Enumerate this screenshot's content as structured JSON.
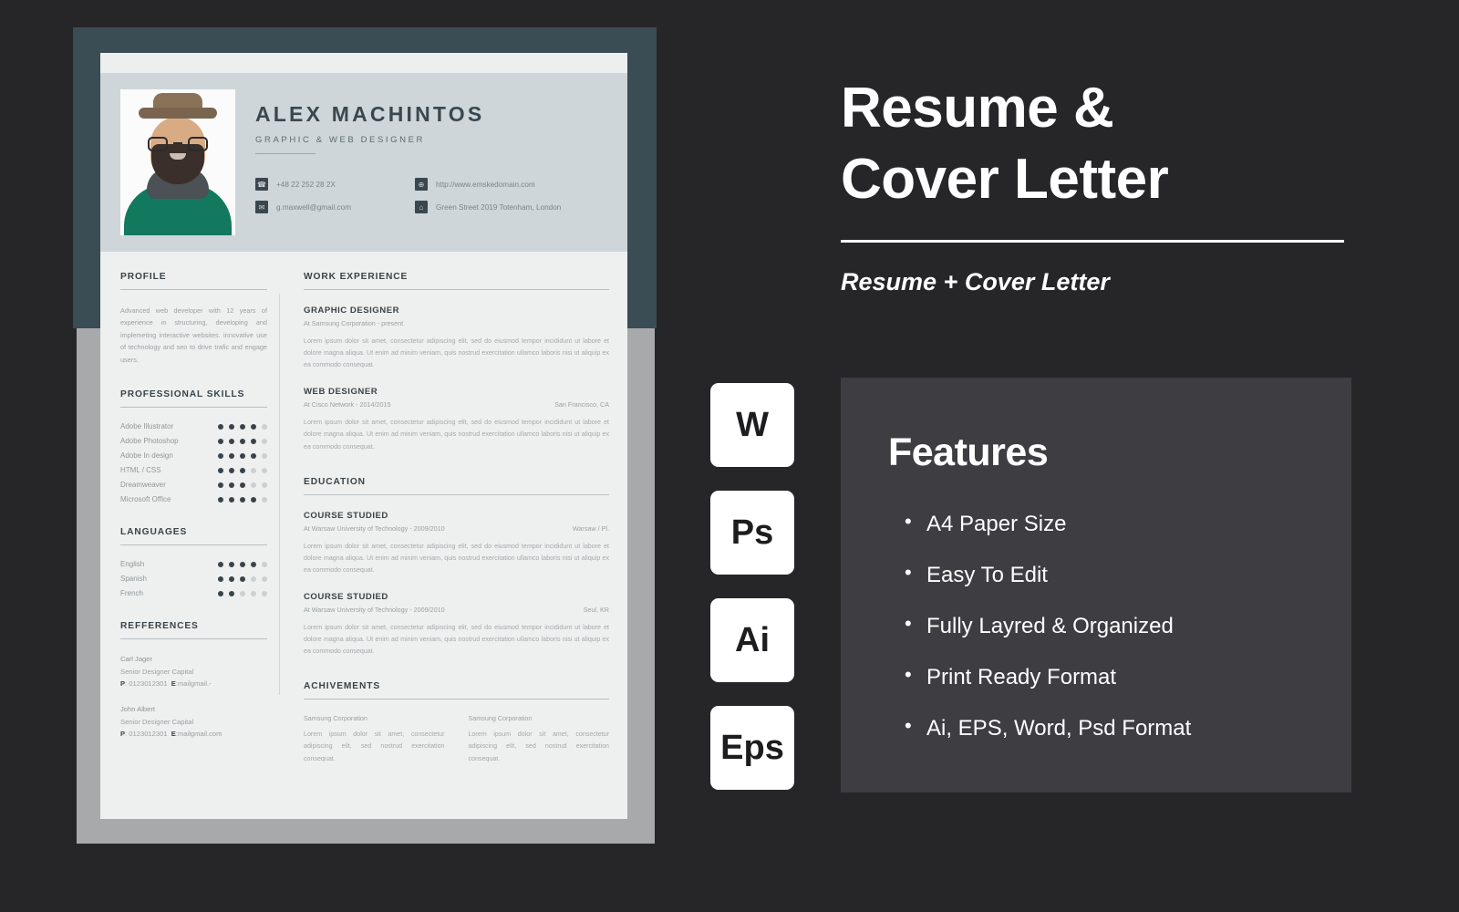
{
  "resume": {
    "name": "ALEX MACHINTOS",
    "role": "GRAPHIC & WEB DESIGNER",
    "contacts": [
      {
        "icon": "phone-icon",
        "glyph": "☎",
        "text": "+48 22 252 28 2X"
      },
      {
        "icon": "globe-icon",
        "glyph": "⊕",
        "text": "http://www.emskedomain.com"
      },
      {
        "icon": "mail-icon",
        "glyph": "✉",
        "text": "g.maxwell@gmail.com"
      },
      {
        "icon": "home-icon",
        "glyph": "⌂",
        "text": "Green Street 2019 Totenham, London"
      }
    ],
    "profile": {
      "heading": "PROFILE",
      "body": "Advanced web developer with 12 years of experience in structuring, developing and implemeting interactive websites. innovative use of technology and seo to drive trafic and engage users."
    },
    "skills": {
      "heading": "PROFESSIONAL SKILLS",
      "max": 5,
      "items": [
        {
          "label": "Adobe Illustrator",
          "value": 4
        },
        {
          "label": "Adobe Photoshop",
          "value": 4
        },
        {
          "label": "Adobe In design",
          "value": 4
        },
        {
          "label": "HTML / CSS",
          "value": 3
        },
        {
          "label": "Dreamweaver",
          "value": 3
        },
        {
          "label": "Microsoft Office",
          "value": 4
        }
      ]
    },
    "languages": {
      "heading": "LANGUAGES",
      "max": 5,
      "items": [
        {
          "label": "English",
          "value": 4
        },
        {
          "label": "Spanish",
          "value": 3
        },
        {
          "label": "French",
          "value": 2
        }
      ]
    },
    "references": {
      "heading": "REFFERENCES",
      "items": [
        {
          "name": "Carl Jager",
          "title": "Senior Designer Capital",
          "phone_label": "P",
          "phone": ": 0123012301",
          "email_label": "E",
          "email": ":mailgmail.-"
        },
        {
          "name": "John Albert",
          "title": "Senior Designer Capital",
          "phone_label": "P",
          "phone": ": 0123012301",
          "email_label": "E",
          "email": ":mailgmail.com"
        }
      ]
    },
    "work": {
      "heading": "WORK EXPERIENCE",
      "items": [
        {
          "title": "GRAPHIC DESIGNER",
          "meta_left": "At Samsung Corporation - present",
          "meta_right": "",
          "body": "Lorem ipsum dolor sit amet, consectetur adipiscing elit, sed do eiusmod tempor incididunt ut labore et dolore magna aliqua. Ut enim ad minim veniam, quis nostrud exercitation ullamco laboris nisi ut aliquip ex ea commodo consequat."
        },
        {
          "title": "WEB DESIGNER",
          "meta_left": "At Cisco Network - 2014/2015",
          "meta_right": "San Francisco, CA",
          "body": "Lorem ipsum dolor sit amet, consectetur adipiscing elit, sed do eiusmod tempor incididunt ut labore et dolore magna aliqua. Ut enim ad minim veniam, quis nostrud exercitation ullamco laboris nisi ut aliquip ex ea commodo consequat."
        }
      ]
    },
    "education": {
      "heading": "EDUCATION",
      "items": [
        {
          "title": "COURSE STUDIED",
          "meta_left": "At Warsaw University of Technology - 2009/2010",
          "meta_right": "Warsaw / Pl.",
          "body": "Lorem ipsum dolor sit amet, consectetur adipiscing elit, sed do eiusmod tempor incididunt ut labore et dolore magna aliqua. Ut enim ad minim veniam, quis nostrud exercitation ullamco laboris nisi ut aliquip ex ea commodo consequat."
        },
        {
          "title": "COURSE STUDIED",
          "meta_left": "At Warsaw University of Technology - 2009/2010",
          "meta_right": "Seul, KR",
          "body": "Lorem ipsum dolor sit amet, consectetur adipiscing elit, sed do eiusmod tempor incididunt ut labore et dolore magna aliqua. Ut enim ad minim veniam, quis nostrud exercitation ullamco laboris nisi ut aliquip ex ea commodo consequat."
        }
      ]
    },
    "achievements": {
      "heading": "ACHIVEMENTS",
      "items": [
        {
          "org": "Samsung Corporation",
          "body": "Lorem ipsum dolor sit amet, consectetur adipiscing elit, sed nostrud exercitation consequat."
        },
        {
          "org": "Samsung Corporation",
          "body": "Lorem ipsum dolor sit amet, consectetur adipiscing elit, sed nostrud exercitation consequat."
        }
      ]
    }
  },
  "promo": {
    "title_line1": "Resume &",
    "title_line2": "Cover  Letter",
    "subtitle": "Resume + Cover Letter",
    "badges": [
      {
        "name": "word-badge",
        "label": "W"
      },
      {
        "name": "photoshop-badge",
        "label": "Ps"
      },
      {
        "name": "illustrator-badge",
        "label": "Ai"
      },
      {
        "name": "eps-badge",
        "label": "Eps"
      }
    ],
    "features": {
      "heading": "Features",
      "items": [
        "A4 Paper Size",
        "Easy To Edit",
        "Fully Layred & Organized",
        "Print Ready Format",
        "Ai, EPS, Word, Psd Format"
      ]
    }
  },
  "colors": {
    "background": "#262629",
    "teal_panel": "#3a4c54",
    "grey_sheet": "#a8a9ab",
    "page": "#eef0ef",
    "header_band": "#ced6d9",
    "features_panel": "#3d3d42",
    "ink": "#39434a"
  }
}
